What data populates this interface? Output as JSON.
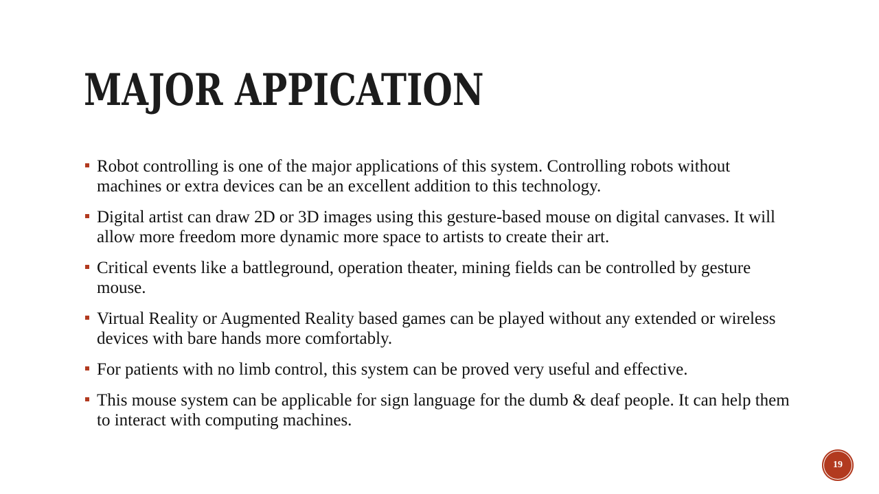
{
  "slide": {
    "title": "Major appication",
    "page_number": "19",
    "accent_color": "#b23a1f",
    "bullets": [
      "Robot controlling is one of the major applications of this system. Controlling robots without machines or extra devices can be an excellent addition to this technology.",
      "Digital artist can draw 2D or 3D images using this gesture-based mouse on digital canvases. It will allow more freedom more dynamic more space to artists to create their art.",
      "Critical events like a battleground, operation theater, mining fields can be controlled by gesture mouse.",
      "Virtual Reality or Augmented Reality based games can be played without any extended or wireless devices with bare hands more comfortably.",
      " For patients with no limb control, this system can be proved very useful and effective.",
      "This mouse system can be applicable for sign language for the dumb & deaf people. It can help them to interact with computing machines."
    ]
  }
}
